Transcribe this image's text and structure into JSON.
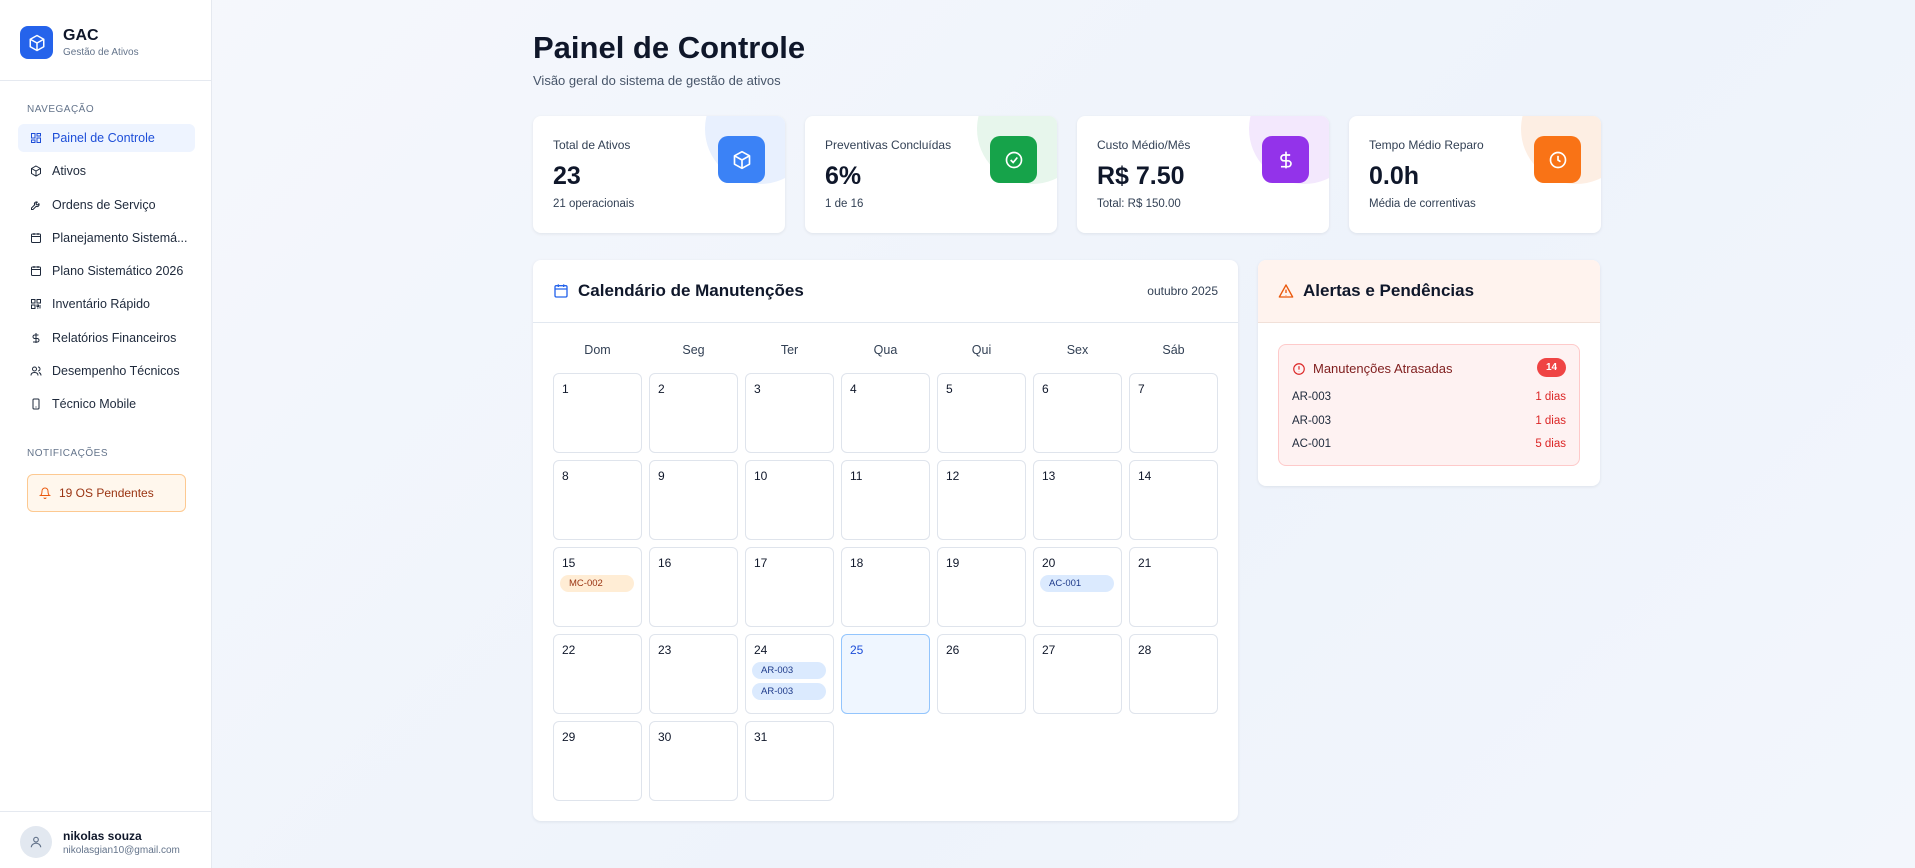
{
  "brand": {
    "name": "GAC",
    "subtitle": "Gestão de Ativos",
    "logo_icon": "cube-icon",
    "color": "#2563eb"
  },
  "sidebar": {
    "nav_section": "NAVEGAÇÃO",
    "items": [
      {
        "label": "Painel de Controle",
        "icon": "dashboard-icon",
        "active": true
      },
      {
        "label": "Ativos",
        "icon": "cube-icon"
      },
      {
        "label": "Ordens de Serviço",
        "icon": "wrench-icon"
      },
      {
        "label": "Planejamento Sistemá...",
        "icon": "calendar-icon"
      },
      {
        "label": "Plano Sistemático 2026",
        "icon": "calendar-icon"
      },
      {
        "label": "Inventário Rápido",
        "icon": "qr-icon"
      },
      {
        "label": "Relatórios Financeiros",
        "icon": "dollar-icon"
      },
      {
        "label": "Desempenho Técnicos",
        "icon": "users-icon"
      },
      {
        "label": "Técnico Mobile",
        "icon": "phone-icon"
      }
    ],
    "notif_section": "NOTIFICAÇÕES",
    "notification": {
      "label": "19 OS Pendentes",
      "icon": "bell-icon"
    }
  },
  "user": {
    "name": "nikolas souza",
    "email": "nikolasgian10@gmail.com",
    "icon": "user-icon"
  },
  "header": {
    "title": "Painel de Controle",
    "subtitle": "Visão geral do sistema de gestão de ativos"
  },
  "stats": [
    {
      "label": "Total de Ativos",
      "value": "23",
      "footnote": "21 operacionais",
      "icon": "cube-icon",
      "color": "#3b82f6",
      "tint": "#e8f0fe"
    },
    {
      "label": "Preventivas Concluídas",
      "value": "6%",
      "footnote": "1 de 16",
      "icon": "check-circle-icon",
      "color": "#16a34a",
      "tint": "#e7f6ec"
    },
    {
      "label": "Custo Médio/Mês",
      "value": "R$ 7.50",
      "footnote": "Total: R$ 150.00",
      "icon": "dollar-icon",
      "color": "#9333ea",
      "tint": "#f3e8fd"
    },
    {
      "label": "Tempo Médio Reparo",
      "value": "0.0h",
      "footnote": "Média de correntivas",
      "icon": "clock-icon",
      "color": "#f97316",
      "tint": "#fdeee3"
    }
  ],
  "calendar": {
    "title": "Calendário de Manutenções",
    "month": "outubro 2025",
    "weekdays": [
      "Dom",
      "Seg",
      "Ter",
      "Qua",
      "Qui",
      "Sex",
      "Sáb"
    ],
    "today": 25,
    "days_in_month": 31,
    "events": [
      {
        "day": 15,
        "label": "MC-002",
        "color": "orange"
      },
      {
        "day": 20,
        "label": "AC-001",
        "color": "blue"
      },
      {
        "day": 24,
        "label": "AR-003",
        "color": "blue"
      },
      {
        "day": 24,
        "label": "AR-003",
        "color": "blue"
      }
    ]
  },
  "alerts": {
    "title": "Alertas e Pendências",
    "icon": "warning-icon",
    "box": {
      "title": "Manutenções Atrasadas",
      "count": "14",
      "rows": [
        {
          "code": "AR-003",
          "days": "1 dias"
        },
        {
          "code": "AR-003",
          "days": "1 dias"
        },
        {
          "code": "AC-001",
          "days": "5 dias"
        }
      ]
    }
  }
}
